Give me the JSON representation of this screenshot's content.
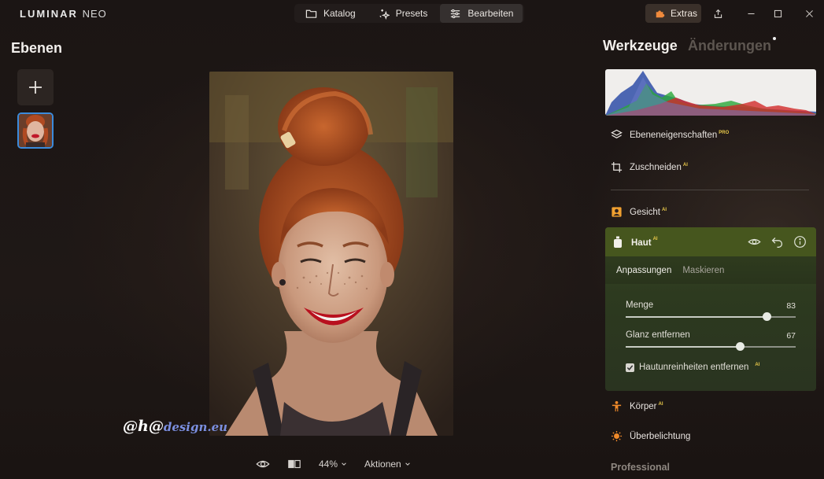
{
  "app": {
    "logo_main": "LUMINAR",
    "logo_sub": "NEO"
  },
  "topnav": {
    "items": [
      {
        "label": "Katalog",
        "icon": "folder-icon"
      },
      {
        "label": "Presets",
        "icon": "sparkle-icon"
      },
      {
        "label": "Bearbeiten",
        "icon": "sliders-icon",
        "active": true
      }
    ]
  },
  "titlebar": {
    "extras_label": "Extras"
  },
  "left_panel": {
    "title": "Ebenen"
  },
  "watermark": {
    "prefix": "@h@",
    "suffix": "design.eu"
  },
  "bottombar": {
    "zoom": "44%",
    "actions": "Aktionen"
  },
  "right_panel": {
    "tab_tools": "Werkzeuge",
    "tab_changes": "Änderungen",
    "tools": [
      {
        "label": "Ebeneneigenschaften",
        "badge": "PRO",
        "icon": "layers-icon"
      },
      {
        "label": "Zuschneiden",
        "badge": "AI",
        "icon": "crop-icon"
      },
      {
        "label": "Gesicht",
        "badge": "AI",
        "icon": "portrait-icon"
      }
    ],
    "haut": {
      "label": "Haut",
      "badge": "AI",
      "subtabs": [
        "Anpassungen",
        "Maskieren"
      ],
      "sliders": [
        {
          "label": "Menge",
          "value": "83",
          "level": 0.83
        },
        {
          "label": "Glanz entfernen",
          "value": "67",
          "level": 0.67
        }
      ],
      "checkbox_label": "Hautunreinheiten entfernen",
      "checkbox_badge": "AI",
      "checked": true
    },
    "tools_after": [
      {
        "label": "Körper",
        "badge": "AI",
        "icon": "body-icon"
      },
      {
        "label": "Überbelichtung",
        "badge": "",
        "icon": "sun-icon"
      }
    ],
    "section": "Professional"
  },
  "colors": {
    "accent_blue": "#3b8bdc",
    "haut_green": "#46561e",
    "badge_gold": "#e8c84a"
  }
}
